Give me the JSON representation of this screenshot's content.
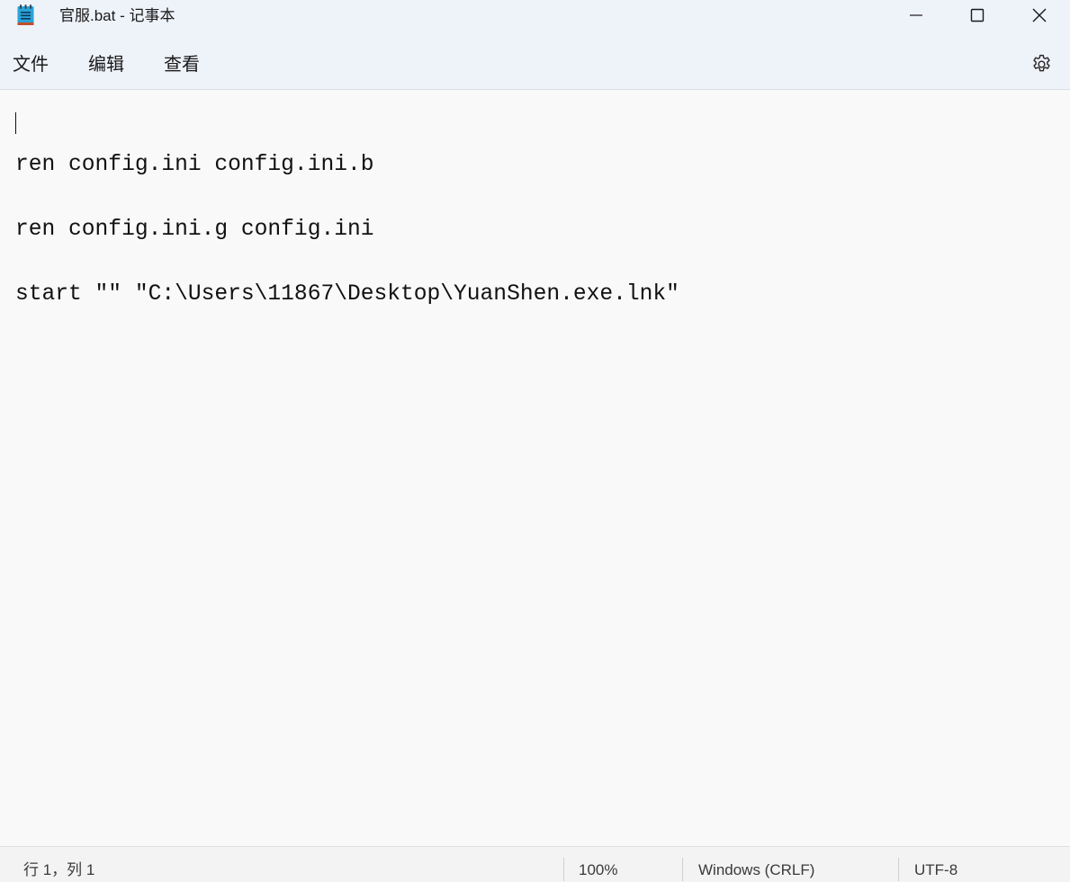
{
  "window": {
    "title": "官服.bat - 记事本",
    "app_icon": "notepad-icon",
    "controls": {
      "minimize_icon": "minimize-icon",
      "maximize_icon": "maximize-icon",
      "close_icon": "close-icon"
    }
  },
  "menubar": {
    "items": [
      {
        "label": "文件"
      },
      {
        "label": "编辑"
      },
      {
        "label": "查看"
      }
    ],
    "settings_icon": "gear-icon"
  },
  "editor": {
    "lines": [
      "ren config.ini config.ini.b",
      "ren config.ini.g config.ini",
      "start \"\" \"C:\\Users\\11867\\Desktop\\YuanShen.exe.lnk\""
    ]
  },
  "statusbar": {
    "position": "行 1，列 1",
    "zoom": "100%",
    "line_ending": "Windows (CRLF)",
    "encoding": "UTF-8"
  },
  "colors": {
    "chrome": "#eef2f9",
    "editor_bg": "#f9f9f9",
    "statusbar_bg": "#f3f3f3",
    "icon_accent": "#2aa3d8"
  }
}
